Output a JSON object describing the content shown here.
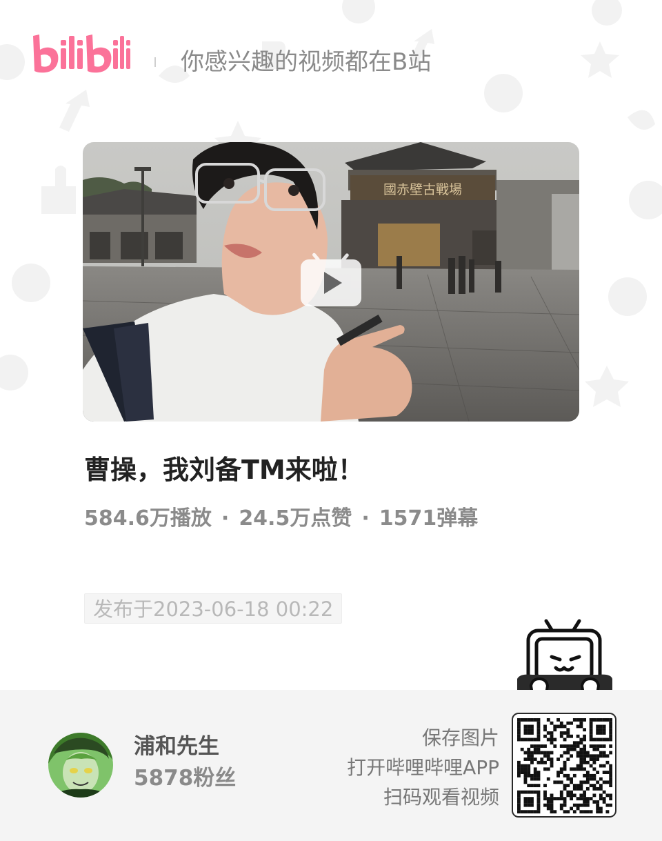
{
  "header": {
    "logo_text": "bilibili",
    "slogan": "你感兴趣的视频都在B站"
  },
  "video": {
    "title": "曹操，我刘备TM来啦！",
    "plays": "584.6万播放",
    "likes": "24.5万点赞",
    "danmaku": "1571弹幕",
    "separator": "·",
    "publish_date": "发布于2023-06-18 00:22",
    "thumbnail_sign_text": "國赤壁古戰場"
  },
  "uploader": {
    "name": "浦和先生",
    "followers": "5878粉丝"
  },
  "cta": {
    "line1": "保存图片",
    "line2": "打开哔哩哔哩APP",
    "line3": "扫码观看视频"
  },
  "colors": {
    "brand_pink": "#fb7299",
    "footer_bg": "#f4f4f4",
    "title": "#222222",
    "muted": "#8b8b8b"
  },
  "icons": [
    "bilibili-logo",
    "play-icon",
    "tv-mascot-icon",
    "qr-code"
  ]
}
